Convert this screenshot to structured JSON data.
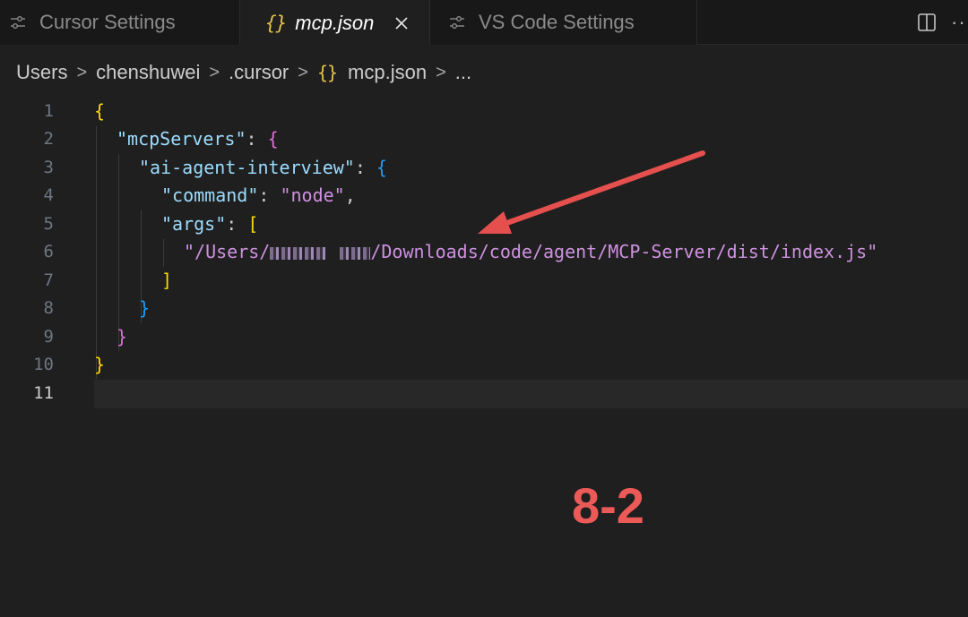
{
  "tabs": [
    {
      "label": "Cursor Settings",
      "icon": "settings-sliders-icon",
      "active": false
    },
    {
      "label": "mcp.json",
      "icon": "json-braces-icon",
      "icon_text": "{}",
      "active": true
    },
    {
      "label": "VS Code Settings",
      "icon": "settings-sliders-icon",
      "active": false
    }
  ],
  "tab_actions": {
    "split_icon": "split-editor-icon",
    "more_text": "···"
  },
  "breadcrumb": {
    "items": [
      "Users",
      "chenshuwei",
      ".cursor",
      "mcp.json",
      "..."
    ],
    "separator": ">",
    "file_icon_text": "{}"
  },
  "editor": {
    "line_numbers": [
      "1",
      "2",
      "3",
      "4",
      "5",
      "6",
      "7",
      "8",
      "9",
      "10",
      "11"
    ],
    "current_line": 11,
    "code": {
      "l1_open": "{",
      "l2_key": "\"mcpServers\"",
      "l2_colon": ": ",
      "l2_open": "{",
      "l3_key": "\"ai-agent-interview\"",
      "l3_colon": ": ",
      "l3_open": "{",
      "l4_key": "\"command\"",
      "l4_colon": ": ",
      "l4_value": "\"node\"",
      "l4_comma": ",",
      "l5_key": "\"args\"",
      "l5_colon": ": ",
      "l5_open": "[",
      "l6_value_start": "\"/Users/",
      "l6_value_end": "/Downloads/code/agent/MCP-Server/dist/index.js\"",
      "l7_close": "]",
      "l8_close": "}",
      "l9_close": "}",
      "l10_close": "}"
    }
  },
  "annotation": {
    "label": "8-2",
    "color": "#ec5a58"
  },
  "colors": {
    "background": "#1f1f1f",
    "tabbar": "#181818",
    "json_key": "#9cdcfe",
    "json_string": "#ce91e0",
    "bracket_level1": "#ffd700",
    "bracket_level2": "#da70d6",
    "bracket_level3": "#179fff"
  }
}
